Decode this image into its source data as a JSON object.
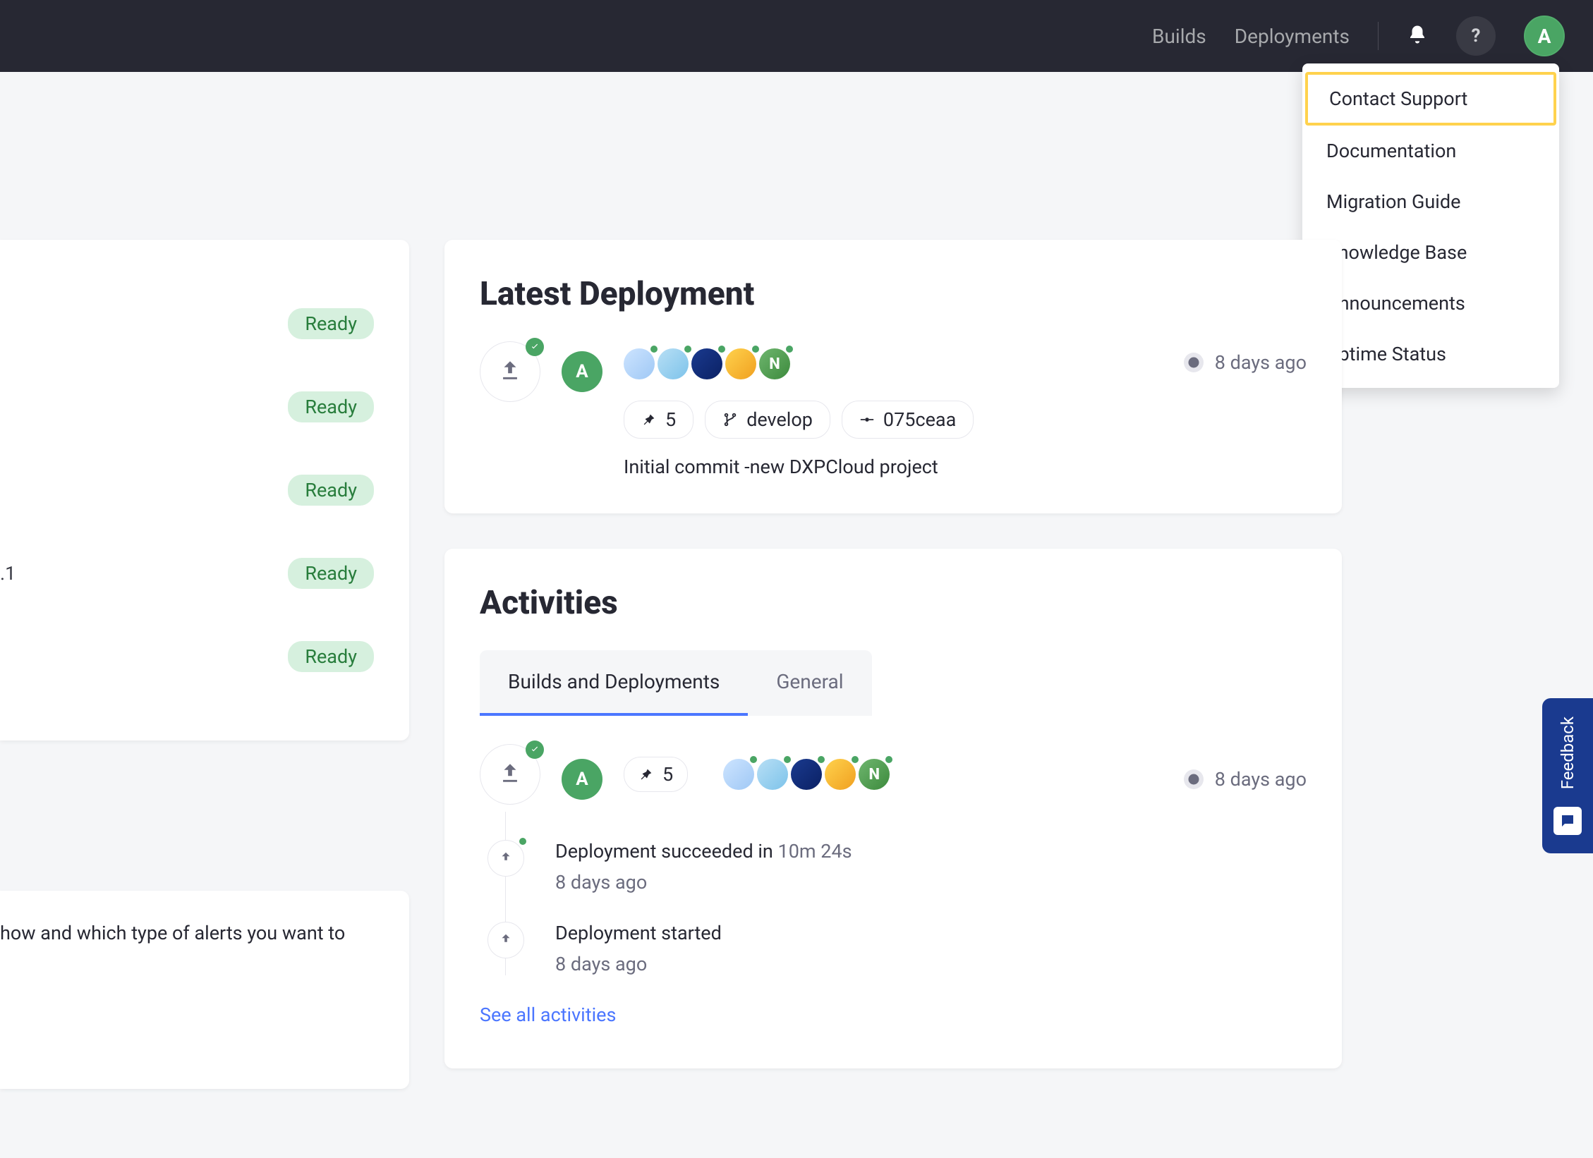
{
  "nav": {
    "builds": "Builds",
    "deployments": "Deployments",
    "help_badge": "?",
    "avatar_initial": "A"
  },
  "help_menu": {
    "items": [
      "Contact Support",
      "Documentation",
      "Migration Guide",
      "Knowledge Base",
      "Announcements",
      "Uptime Status"
    ]
  },
  "sidebar": {
    "statuses": [
      "Ready",
      "Ready",
      "Ready",
      "Ready",
      "Ready"
    ],
    "version_fragment": ".1",
    "note": "how and which type of alerts you want to"
  },
  "latest_deployment": {
    "title": "Latest Deployment",
    "avatar": "A",
    "build_number": "5",
    "branch": "develop",
    "commit": "075ceaa",
    "message": "Initial commit -new DXPCloud project",
    "time": "8 days ago"
  },
  "activities": {
    "title": "Activities",
    "tabs": [
      "Builds and Deployments",
      "General"
    ],
    "active_tab": 0,
    "head": {
      "avatar": "A",
      "build_number": "5",
      "time": "8 days ago"
    },
    "items": [
      {
        "title_prefix": "Deployment succeeded in ",
        "title_muted": "10m 24s",
        "sub": "8 days ago",
        "green": true
      },
      {
        "title_prefix": "Deployment started",
        "title_muted": "",
        "sub": "8 days ago",
        "green": false
      }
    ],
    "see_all": "See all activities"
  },
  "feedback": {
    "label": "Feedback"
  },
  "svc5_letter": "N"
}
